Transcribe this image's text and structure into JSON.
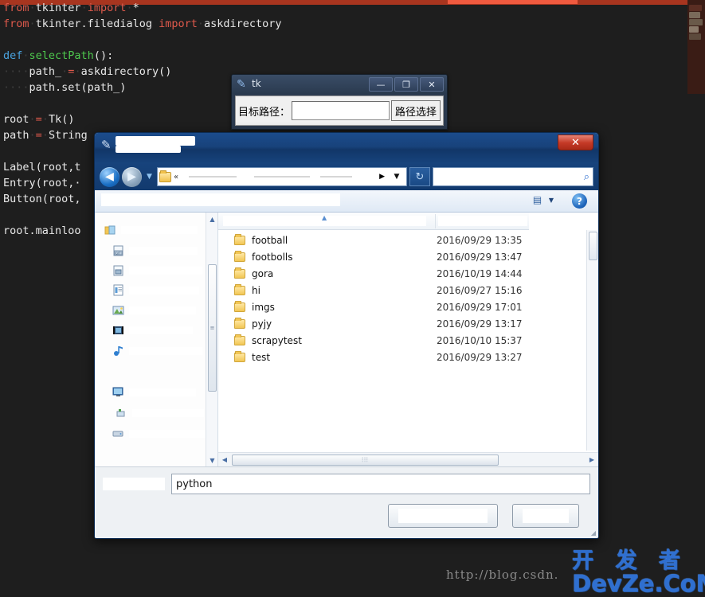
{
  "editor": {
    "lines": [
      [
        {
          "t": "from",
          "c": "kw"
        },
        {
          "t": "·",
          "c": "dots"
        },
        {
          "t": "tkinter",
          "c": "pln"
        },
        {
          "t": "·",
          "c": "dots"
        },
        {
          "t": "import",
          "c": "kw"
        },
        {
          "t": "·",
          "c": "dots"
        },
        {
          "t": "*",
          "c": "pln"
        }
      ],
      [
        {
          "t": "from",
          "c": "kw"
        },
        {
          "t": "·",
          "c": "dots"
        },
        {
          "t": "tkinter.filedialog",
          "c": "pln"
        },
        {
          "t": " ",
          "c": "pln"
        },
        {
          "t": "import",
          "c": "kw"
        },
        {
          "t": "·",
          "c": "dots"
        },
        {
          "t": "askdirectory",
          "c": "pln"
        }
      ],
      [],
      [
        {
          "t": "def",
          "c": "def"
        },
        {
          "t": "·",
          "c": "dots"
        },
        {
          "t": "selectPath",
          "c": "fn"
        },
        {
          "t": "():",
          "c": "pln"
        }
      ],
      [
        {
          "t": "····",
          "c": "dots"
        },
        {
          "t": "path_",
          "c": "pln"
        },
        {
          "t": "·",
          "c": "dots"
        },
        {
          "t": "=",
          "c": "op"
        },
        {
          "t": "·",
          "c": "dots"
        },
        {
          "t": "askdirectory()",
          "c": "pln"
        }
      ],
      [
        {
          "t": "····",
          "c": "dots"
        },
        {
          "t": "path.set(path_)",
          "c": "pln"
        }
      ],
      [],
      [
        {
          "t": "root",
          "c": "pln"
        },
        {
          "t": "·",
          "c": "dots"
        },
        {
          "t": "=",
          "c": "op"
        },
        {
          "t": "·",
          "c": "dots"
        },
        {
          "t": "Tk()",
          "c": "pln"
        }
      ],
      [
        {
          "t": "path",
          "c": "pln"
        },
        {
          "t": "·",
          "c": "dots"
        },
        {
          "t": "=",
          "c": "op"
        },
        {
          "t": "·",
          "c": "dots"
        },
        {
          "t": "String",
          "c": "pln"
        }
      ],
      [],
      [
        {
          "t": "Label(root,t",
          "c": "pln"
        }
      ],
      [
        {
          "t": "Entry(root,·",
          "c": "pln"
        }
      ],
      [
        {
          "t": "Button(root,",
          "c": "pln"
        }
      ],
      [],
      [
        {
          "t": "root.mainloo",
          "c": "pln"
        }
      ]
    ],
    "watermark_url": "http://blog.csdn.",
    "watermark_cn": "开 发 者",
    "watermark_en": "DevZe.CoM"
  },
  "tk_window": {
    "title": "tk",
    "minimize": "—",
    "maximize": "❐",
    "close": "✕",
    "path_label": "目标路径：",
    "path_value": "",
    "select_button": "路径选择"
  },
  "file_dialog": {
    "title": "",
    "close": "✕",
    "nav": {
      "back": "◀",
      "forward": "▶",
      "history": "▼",
      "address_chevron": "«",
      "address_arrow": "▶",
      "address_dropdown": "▼",
      "refresh": "↻"
    },
    "search": {
      "value": "",
      "icon": "⌕"
    },
    "toolbar": {
      "views_icon": "▤",
      "views_chevron": "▼",
      "help": "?"
    },
    "columns": {
      "sort_arrow": "▲"
    },
    "files": [
      {
        "name": "football",
        "date": "2016/09/29 13:35"
      },
      {
        "name": "footbolls",
        "date": "2016/09/29 13:47"
      },
      {
        "name": "gora",
        "date": "2016/10/19 14:44"
      },
      {
        "name": "hi",
        "date": "2016/09/27 15:16"
      },
      {
        "name": "imgs",
        "date": "2016/09/29 17:01"
      },
      {
        "name": "pyjy",
        "date": "2016/09/29 13:17"
      },
      {
        "name": "scrapytest",
        "date": "2016/10/10 15:37"
      },
      {
        "name": "test",
        "date": "2016/09/29 13:27"
      }
    ],
    "scroll": {
      "up": "▲",
      "down": "▼",
      "left": "◀",
      "right": "▶",
      "grip": "⦙⦙⦙",
      "thumb_grip": "≡"
    },
    "filename": {
      "value": "python"
    },
    "buttons": {
      "ok": "",
      "cancel": ""
    },
    "resize_grip": "◢"
  }
}
